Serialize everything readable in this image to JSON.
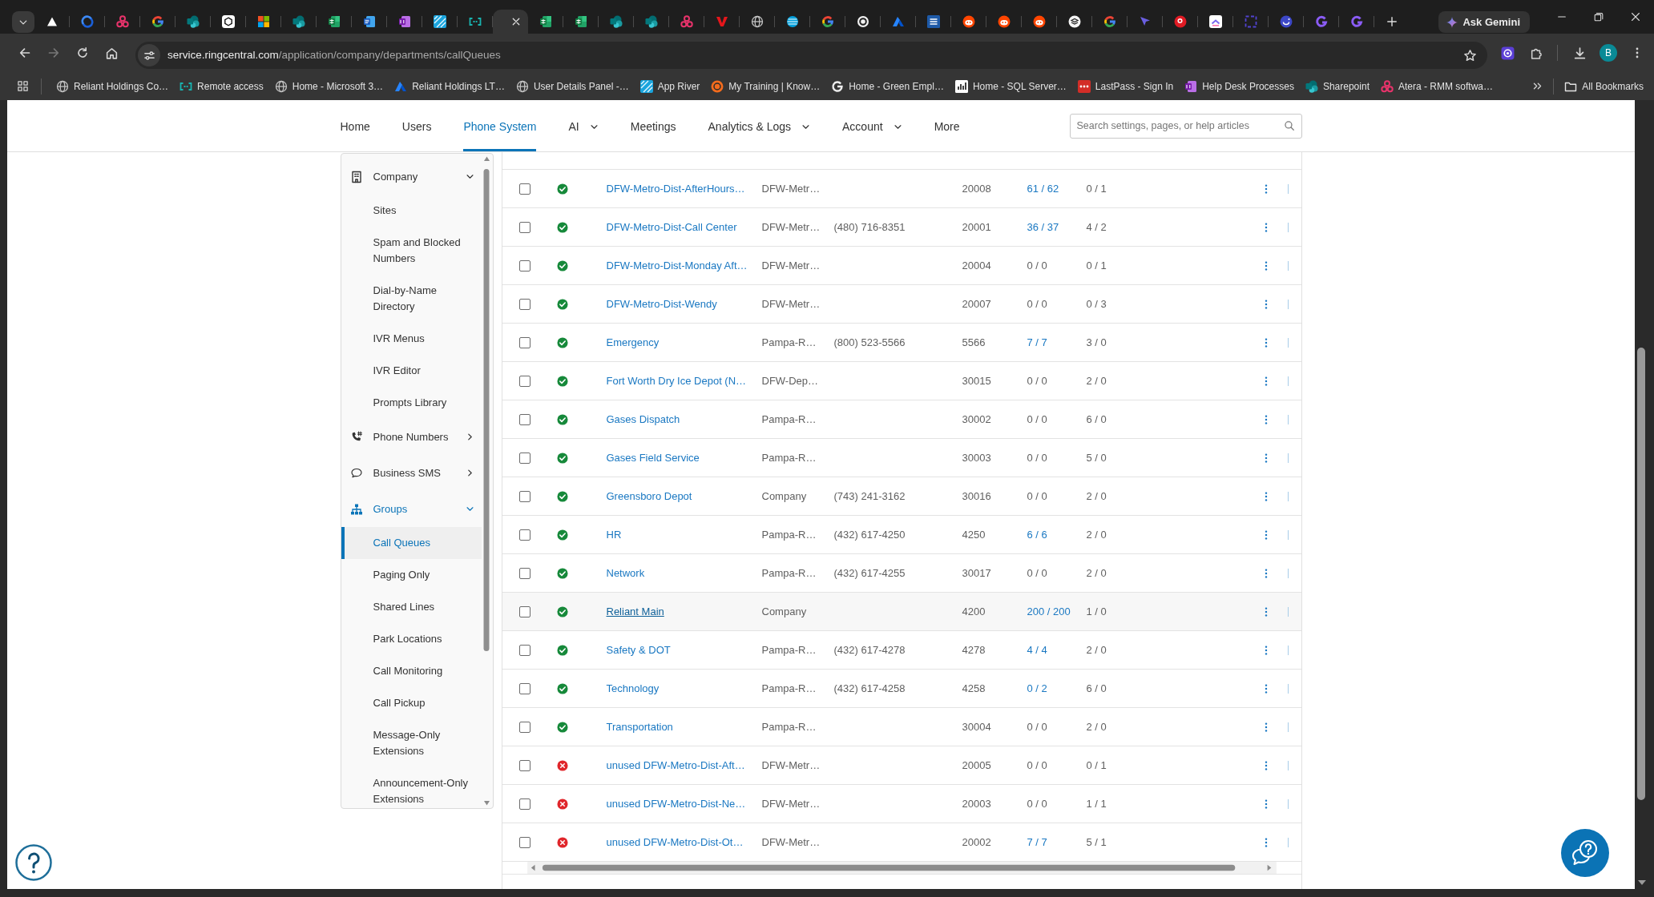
{
  "browser": {
    "tabs": [
      {
        "selected": false
      },
      {
        "selected": false
      },
      {
        "selected": false
      },
      {
        "selected": false
      },
      {
        "selected": false
      },
      {
        "selected": false
      },
      {
        "selected": false
      },
      {
        "selected": false
      },
      {
        "selected": false
      },
      {
        "selected": false
      },
      {
        "selected": false
      },
      {
        "selected": false
      },
      {
        "selected": false
      },
      {
        "selected": true
      },
      {
        "selected": false
      },
      {
        "selected": false
      },
      {
        "selected": false
      },
      {
        "selected": false
      },
      {
        "selected": false
      },
      {
        "selected": false
      },
      {
        "selected": false
      },
      {
        "selected": false
      },
      {
        "selected": false
      },
      {
        "selected": false
      },
      {
        "selected": false
      },
      {
        "selected": false
      },
      {
        "selected": false
      },
      {
        "selected": false
      },
      {
        "selected": false
      },
      {
        "selected": false
      },
      {
        "selected": false
      },
      {
        "selected": false
      },
      {
        "selected": false
      },
      {
        "selected": false
      },
      {
        "selected": false
      },
      {
        "selected": false
      },
      {
        "selected": false
      },
      {
        "selected": false
      }
    ],
    "ask_button": "Ask Gemini",
    "back_disabled": false,
    "forward_disabled": true,
    "url": {
      "domain": "service.ringcentral.com",
      "path": "/application/company/departments/callQueues"
    },
    "profile_initial": "B",
    "bookmarks": [
      {
        "label": "Reliant Holdings Co…"
      },
      {
        "label": "Remote access"
      },
      {
        "label": "Home - Microsoft 3…"
      },
      {
        "label": "Reliant Holdings LT…"
      },
      {
        "label": "User Details Panel -…"
      },
      {
        "label": "App River"
      },
      {
        "label": "My Training | Know…"
      },
      {
        "label": "Home - Green Empl…"
      },
      {
        "label": "Home - SQL Server…"
      },
      {
        "label": "LastPass - Sign In"
      },
      {
        "label": "Help Desk Processes"
      },
      {
        "label": "Sharepoint"
      },
      {
        "label": "Atera - RMM softwa…"
      }
    ],
    "all_bookmarks": "All Bookmarks"
  },
  "nav": {
    "items": [
      {
        "label": "Home",
        "kind": "link",
        "selected": false
      },
      {
        "label": "Users",
        "kind": "link",
        "selected": false
      },
      {
        "label": "Phone System",
        "kind": "link",
        "selected": true
      },
      {
        "label": "AI",
        "kind": "menu",
        "selected": false
      },
      {
        "label": "Meetings",
        "kind": "link",
        "selected": false
      },
      {
        "label": "Analytics & Logs",
        "kind": "menu",
        "selected": false
      },
      {
        "label": "Account",
        "kind": "menu",
        "selected": false
      },
      {
        "label": "More",
        "kind": "link",
        "selected": false
      }
    ],
    "search": {
      "placeholder": "Search settings, pages, or help articles"
    }
  },
  "sidebar": {
    "items": [
      {
        "label": "Company",
        "expanded": true,
        "active": false,
        "children": [
          {
            "label": "Sites",
            "selected": false
          },
          {
            "label": "Spam and Blocked Numbers",
            "selected": false
          },
          {
            "label": "Dial-by-Name Directory",
            "selected": false
          },
          {
            "label": "IVR Menus",
            "selected": false
          },
          {
            "label": "IVR Editor",
            "selected": false
          },
          {
            "label": "Prompts Library",
            "selected": false
          }
        ]
      },
      {
        "label": "Phone Numbers",
        "expanded": false,
        "active": false
      },
      {
        "label": "Business SMS",
        "expanded": false,
        "active": false
      },
      {
        "label": "Groups",
        "expanded": true,
        "active": true,
        "children": [
          {
            "label": "Call Queues",
            "selected": true
          },
          {
            "label": "Paging Only",
            "selected": false
          },
          {
            "label": "Shared Lines",
            "selected": false
          },
          {
            "label": "Park Locations",
            "selected": false
          },
          {
            "label": "Call Monitoring",
            "selected": false
          },
          {
            "label": "Call Pickup",
            "selected": false
          },
          {
            "label": "Message-Only Extensions",
            "selected": false
          },
          {
            "label": "Announcement-Only Extensions",
            "selected": false
          }
        ]
      }
    ]
  },
  "table": {
    "rows": [
      {
        "checked": false,
        "enabled": true,
        "hovered": false,
        "column_3": "DFW-Metro-Dist-AfterHours…",
        "column_4": "DFW-Metr…",
        "column_6": "20008",
        "column_7": {
          "text": "61 / 62",
          "link": true
        },
        "column_8": "0 / 1"
      },
      {
        "checked": false,
        "enabled": true,
        "hovered": false,
        "column_3": "DFW-Metro-Dist-Call Center",
        "column_4": "DFW-Metr…",
        "column_5": "(480) 716-8351",
        "column_6": "20001",
        "column_7": {
          "text": "36 / 37",
          "link": true
        },
        "column_8": "4 / 2"
      },
      {
        "checked": false,
        "enabled": true,
        "hovered": false,
        "column_3": "DFW-Metro-Dist-Monday Aft…",
        "column_4": "DFW-Metr…",
        "column_6": "20004",
        "column_7": {
          "text": "0 / 0",
          "link": false
        },
        "column_8": "0 / 1"
      },
      {
        "checked": false,
        "enabled": true,
        "hovered": false,
        "column_3": "DFW-Metro-Dist-Wendy",
        "column_4": "DFW-Metr…",
        "column_6": "20007",
        "column_7": {
          "text": "0 / 0",
          "link": false
        },
        "column_8": "0 / 3"
      },
      {
        "checked": false,
        "enabled": true,
        "hovered": false,
        "column_3": "Emergency",
        "column_4": "Pampa-R…",
        "column_5": "(800) 523-5566",
        "column_6": "5566",
        "column_7": {
          "text": "7 / 7",
          "link": true
        },
        "column_8": "3 / 0"
      },
      {
        "checked": false,
        "enabled": true,
        "hovered": false,
        "column_3": "Fort Worth Dry Ice Depot (N…",
        "column_4": "DFW-Dep…",
        "column_6": "30015",
        "column_7": {
          "text": "0 / 0",
          "link": false
        },
        "column_8": "2 / 0"
      },
      {
        "checked": false,
        "enabled": true,
        "hovered": false,
        "column_3": "Gases Dispatch",
        "column_4": "Pampa-R…",
        "column_6": "30002",
        "column_7": {
          "text": "0 / 0",
          "link": false
        },
        "column_8": "6 / 0"
      },
      {
        "checked": false,
        "enabled": true,
        "hovered": false,
        "column_3": "Gases Field Service",
        "column_4": "Pampa-R…",
        "column_6": "30003",
        "column_7": {
          "text": "0 / 0",
          "link": false
        },
        "column_8": "5 / 0"
      },
      {
        "checked": false,
        "enabled": true,
        "hovered": false,
        "column_3": "Greensboro Depot",
        "column_4": "Company",
        "column_5": "(743) 241-3162",
        "column_6": "30016",
        "column_7": {
          "text": "0 / 0",
          "link": false
        },
        "column_8": "2 / 0"
      },
      {
        "checked": false,
        "enabled": true,
        "hovered": false,
        "column_3": "HR",
        "column_4": "Pampa-R…",
        "column_5": "(432) 617-4250",
        "column_6": "4250",
        "column_7": {
          "text": "6 / 6",
          "link": true
        },
        "column_8": "2 / 0"
      },
      {
        "checked": false,
        "enabled": true,
        "hovered": false,
        "column_3": "Network",
        "column_4": "Pampa-R…",
        "column_5": "(432) 617-4255",
        "column_6": "30017",
        "column_7": {
          "text": "0 / 0",
          "link": false
        },
        "column_8": "2 / 0"
      },
      {
        "checked": false,
        "enabled": true,
        "hovered": true,
        "column_3": "Reliant Main",
        "column_4": "Company",
        "column_6": "4200",
        "column_7": {
          "text": "200 / 200",
          "link": true
        },
        "column_8": "1 / 0"
      },
      {
        "checked": false,
        "enabled": true,
        "hovered": false,
        "column_3": "Safety & DOT",
        "column_4": "Pampa-R…",
        "column_5": "(432) 617-4278",
        "column_6": "4278",
        "column_7": {
          "text": "4 / 4",
          "link": true
        },
        "column_8": "2 / 0"
      },
      {
        "checked": false,
        "enabled": true,
        "hovered": false,
        "column_3": "Technology",
        "column_4": "Pampa-R…",
        "column_5": "(432) 617-4258",
        "column_6": "4258",
        "column_7": {
          "text": "0 / 2",
          "link": true
        },
        "column_8": "6 / 0"
      },
      {
        "checked": false,
        "enabled": true,
        "hovered": false,
        "column_3": "Transportation",
        "column_4": "Pampa-R…",
        "column_6": "30004",
        "column_7": {
          "text": "0 / 0",
          "link": false
        },
        "column_8": "2 / 0"
      },
      {
        "checked": false,
        "enabled": false,
        "hovered": false,
        "column_3": "unused DFW-Metro-Dist-Aft…",
        "column_4": "DFW-Metr…",
        "column_6": "20005",
        "column_7": {
          "text": "0 / 0",
          "link": false
        },
        "column_8": "0 / 1"
      },
      {
        "checked": false,
        "enabled": false,
        "hovered": false,
        "column_3": "unused DFW-Metro-Dist-Ne…",
        "column_4": "DFW-Metr…",
        "column_6": "20003",
        "column_7": {
          "text": "0 / 0",
          "link": false
        },
        "column_8": "1 / 1"
      },
      {
        "checked": false,
        "enabled": false,
        "hovered": false,
        "column_3": "unused DFW-Metro-Dist-Ot…",
        "column_4": "DFW-Metr…",
        "column_6": "20002",
        "column_7": {
          "text": "7 / 7",
          "link": true
        },
        "column_8": "5 / 1"
      }
    ]
  }
}
